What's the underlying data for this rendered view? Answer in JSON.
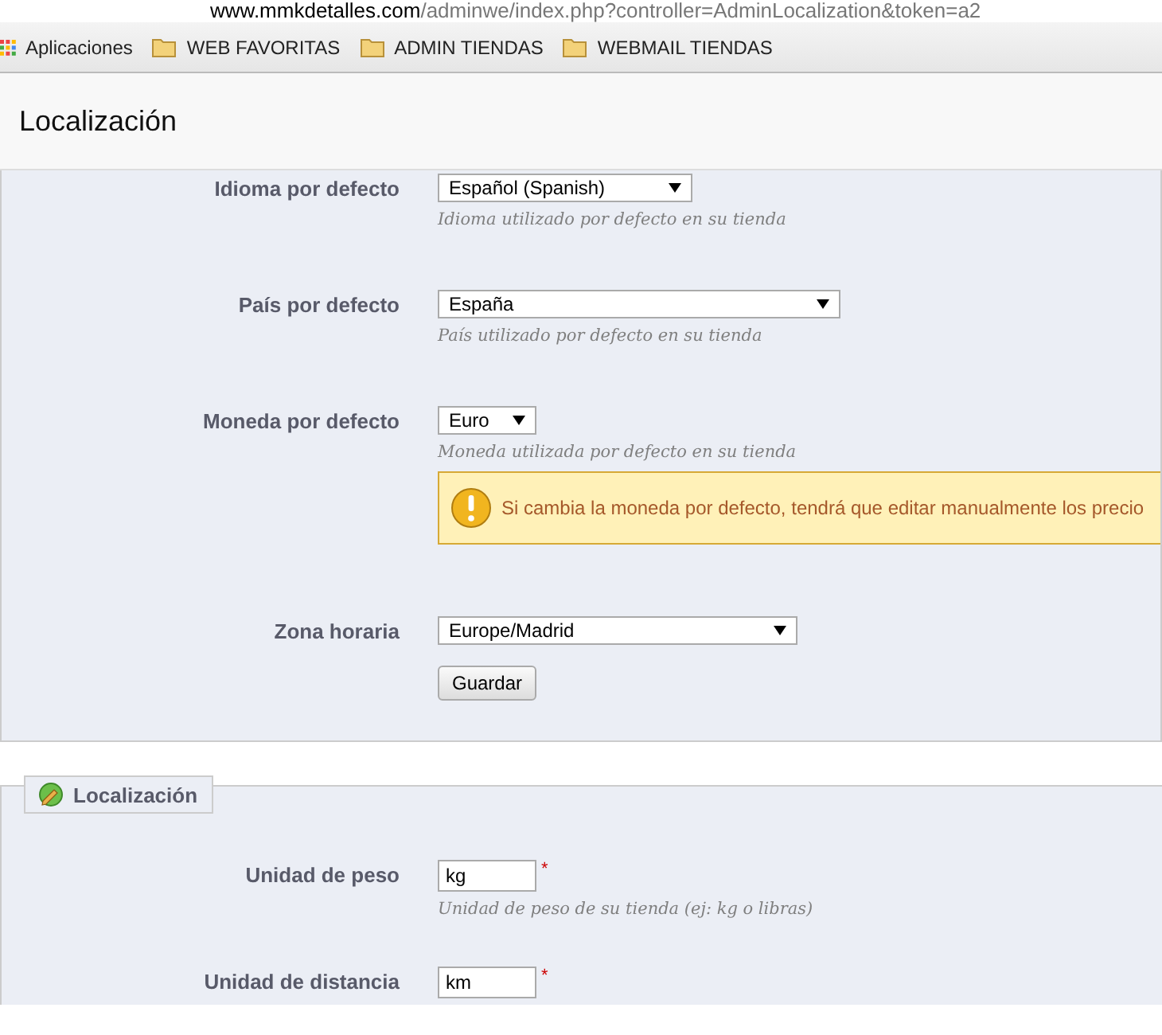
{
  "browser": {
    "url_host": "www.mmkdetalles.com",
    "url_path": "/adminwe/index.php?controller=AdminLocalization&token=a2",
    "bookmarks": [
      {
        "kind": "apps",
        "label": "Aplicaciones"
      },
      {
        "kind": "folder",
        "label": "WEB FAVORITAS"
      },
      {
        "kind": "folder",
        "label": "ADMIN TIENDAS"
      },
      {
        "kind": "folder",
        "label": "WEBMAIL TIENDAS"
      }
    ]
  },
  "page": {
    "title": "Localización"
  },
  "config_panel": {
    "fields": [
      {
        "kind": "select",
        "label": "Idioma por defecto",
        "value": "Español (Spanish)",
        "hint": "Idioma utilizado por defecto en su tienda"
      },
      {
        "kind": "select",
        "label": "País por defecto",
        "value": "España",
        "hint": "País utilizado por defecto en su tienda"
      },
      {
        "kind": "select",
        "label": "Moneda por defecto",
        "value": "Euro",
        "hint": "Moneda utilizada por defecto en su tienda",
        "warning": "Si cambia la moneda por defecto, tendrá que editar manualmente los precio"
      },
      {
        "kind": "select",
        "label": "Zona horaria",
        "value": "Europe/Madrid"
      }
    ],
    "button": "Guardar"
  },
  "units_panel": {
    "legend": "Localización",
    "fields": [
      {
        "kind": "text",
        "label": "Unidad de peso",
        "value": "kg",
        "required": true,
        "required_mark": "*",
        "hint": "Unidad de peso de su tienda (ej: kg o libras)"
      },
      {
        "kind": "text",
        "label": "Unidad de distancia",
        "value": "km",
        "required": true,
        "required_mark": "*"
      }
    ]
  }
}
